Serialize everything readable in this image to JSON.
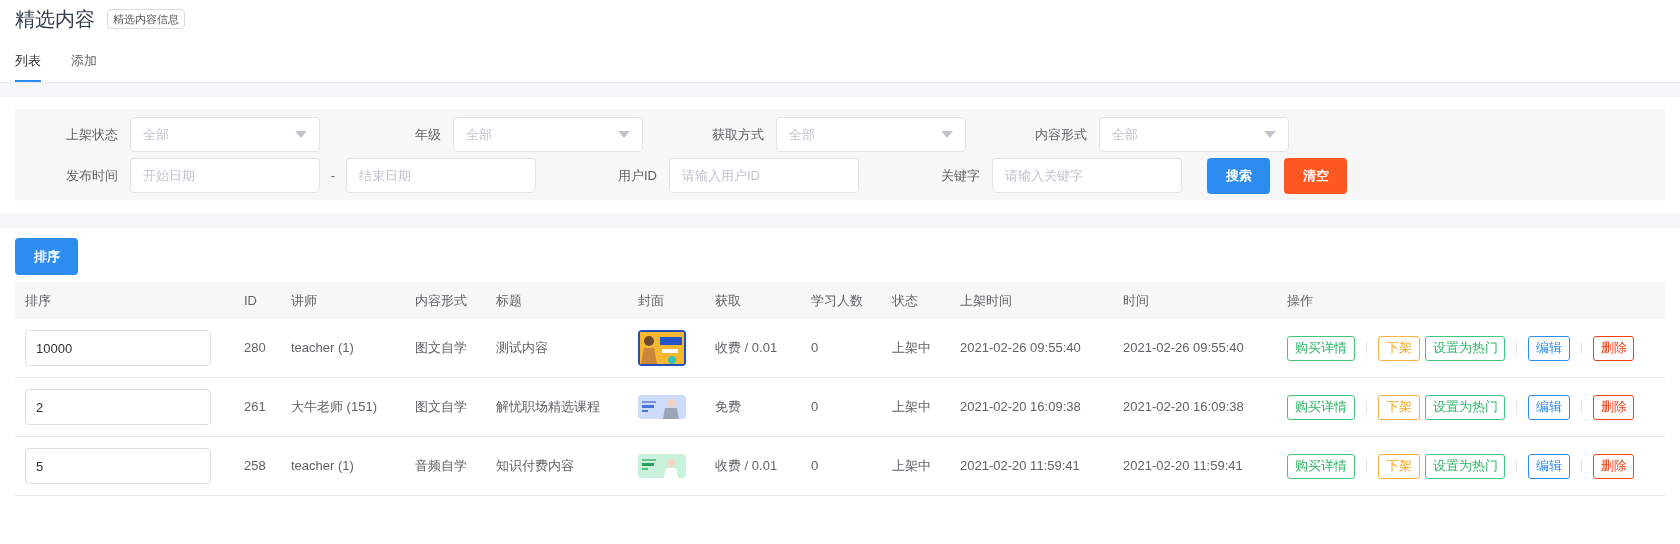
{
  "page": {
    "title": "精选内容",
    "badge": "精选内容信息"
  },
  "tabs": [
    {
      "label": "列表",
      "selected": true
    },
    {
      "label": "添加",
      "selected": false
    }
  ],
  "filters": {
    "rows": [
      [
        {
          "kind": "select",
          "label": "上架状态",
          "value": "全部"
        },
        {
          "kind": "select",
          "label": "年级",
          "value": "全部"
        },
        {
          "kind": "select",
          "label": "获取方式",
          "value": "全部"
        },
        {
          "kind": "select",
          "label": "内容形式",
          "value": "全部"
        }
      ],
      [
        {
          "kind": "daterange",
          "label": "发布时间",
          "start_placeholder": "开始日期",
          "separator": "-",
          "end_placeholder": "结束日期"
        },
        {
          "kind": "input",
          "label": "用户ID",
          "placeholder": "请输入用户ID"
        },
        {
          "kind": "input",
          "label": "关键字",
          "placeholder": "请输入关键字"
        }
      ]
    ],
    "buttons": [
      {
        "label": "搜索",
        "kind": "primary"
      },
      {
        "label": "清空",
        "kind": "danger"
      }
    ]
  },
  "toolbar": {
    "sort_button": "排序"
  },
  "table": {
    "columns": [
      "排序",
      "ID",
      "讲师",
      "内容形式",
      "标题",
      "封面",
      "获取",
      "学习人数",
      "状态",
      "上架时间",
      "时间",
      "操作"
    ],
    "rows": [
      {
        "sort": "10000",
        "id": "280",
        "teacher": "teacher (1)",
        "format": "图文自学",
        "title": "测试内容",
        "access": "收费 / 0.01",
        "learners": "0",
        "status": "上架中",
        "listed_time": "2021-02-26 09:55:40",
        "time": "2021-02-26 09:55:40",
        "actions": [
          {
            "label": "购买详情",
            "kind": "detail"
          },
          {
            "label": "下架",
            "kind": "offline"
          },
          {
            "label": "设置为热门",
            "kind": "hot"
          },
          {
            "label": "编辑",
            "kind": "edit"
          },
          {
            "label": "删除",
            "kind": "delete"
          }
        ]
      },
      {
        "sort": "2",
        "id": "261",
        "teacher": "大牛老师 (151)",
        "format": "图文自学",
        "title": "解忧职场精选课程",
        "access": "免费",
        "learners": "0",
        "status": "上架中",
        "listed_time": "2021-02-20 16:09:38",
        "time": "2021-02-20 16:09:38",
        "actions": [
          {
            "label": "购买详情",
            "kind": "detail"
          },
          {
            "label": "下架",
            "kind": "offline"
          },
          {
            "label": "设置为热门",
            "kind": "hot"
          },
          {
            "label": "编辑",
            "kind": "edit"
          },
          {
            "label": "删除",
            "kind": "delete"
          }
        ]
      },
      {
        "sort": "5",
        "id": "258",
        "teacher": "teacher (1)",
        "format": "音频自学",
        "title": "知识付费内容",
        "access": "收费 / 0.01",
        "learners": "0",
        "status": "上架中",
        "listed_time": "2021-02-20 11:59:41",
        "time": "2021-02-20 11:59:41",
        "actions": [
          {
            "label": "购买详情",
            "kind": "detail"
          },
          {
            "label": "下架",
            "kind": "offline"
          },
          {
            "label": "设置为热门",
            "kind": "hot"
          },
          {
            "label": "编辑",
            "kind": "edit"
          },
          {
            "label": "删除",
            "kind": "delete"
          }
        ]
      }
    ]
  }
}
